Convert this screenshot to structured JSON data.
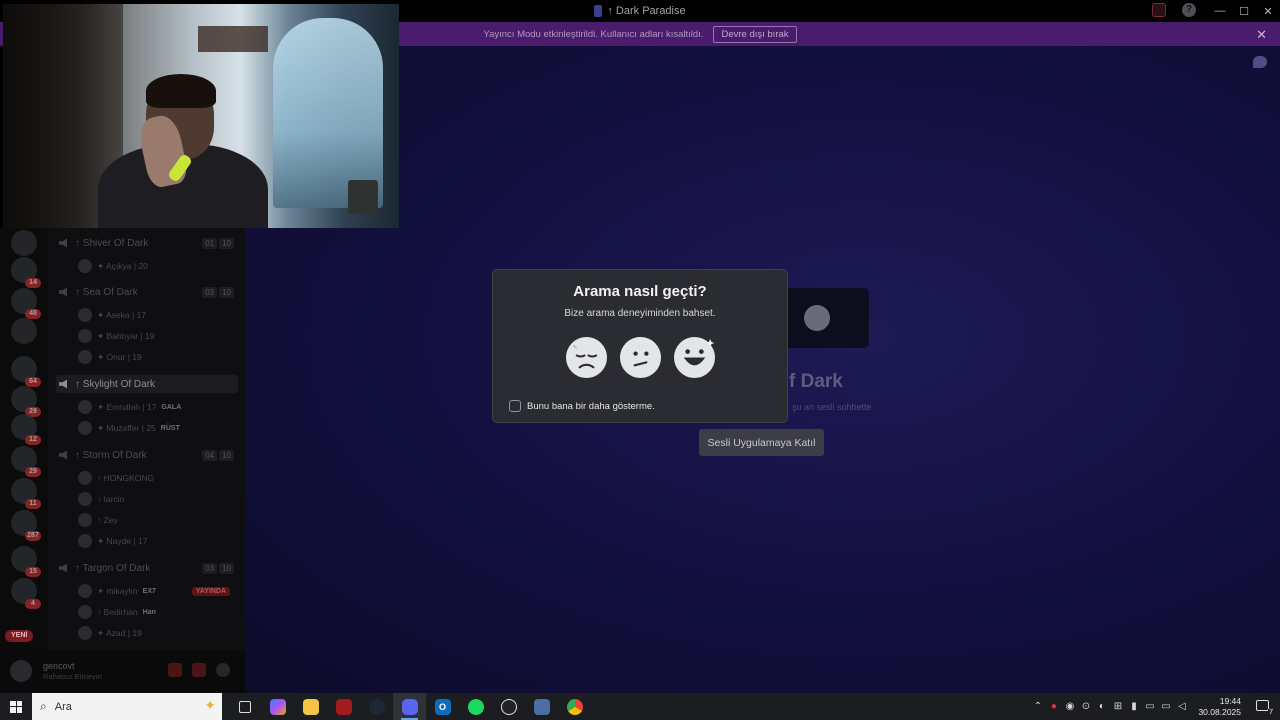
{
  "window": {
    "title": "↑ Dark Paradise",
    "controls": [
      "—",
      "☐",
      "✕"
    ]
  },
  "banner": {
    "text": "Yayıncı Modu etkinleştirildi. Kullanıcı adları kısaltıldı.",
    "button": "Devre dışı bırak",
    "close": "✕"
  },
  "stage": {
    "voice_title": "f Dark",
    "voice_sub": "şu an sesli sohbette",
    "join_button": "Sesli Uygulamaya Katıl"
  },
  "modal": {
    "title": "Arama nasıl geçti?",
    "subtitle": "Bize arama deneyiminden bahset.",
    "ratings": [
      "bad",
      "neutral",
      "good"
    ],
    "checkbox_label": "Bunu bana bir daha gösterme."
  },
  "servers": {
    "badges": [
      "14",
      "48",
      "64",
      "29",
      "12",
      "29",
      "11",
      "287",
      "15",
      "4"
    ],
    "new_label": "YENİ"
  },
  "channels": {
    "items": [
      {
        "name": "↑ Shiver Of Dark",
        "a": "01",
        "b": "10"
      },
      {
        "name": "↑ Sea Of Dark",
        "a": "03",
        "b": "10"
      },
      {
        "name": "↑ Skylight Of Dark",
        "a": "",
        "b": ""
      },
      {
        "name": "↑ Storm Of Dark",
        "a": "04",
        "b": "10"
      },
      {
        "name": "↑ Targon Of Dark",
        "a": "03",
        "b": "10"
      }
    ],
    "users": [
      {
        "name": "✦ Açıkya | 20",
        "tag": "",
        "live": ""
      },
      {
        "name": "✦ Aseka | 17",
        "tag": "",
        "live": ""
      },
      {
        "name": "✦ Bahtıyar | 19",
        "tag": "",
        "live": ""
      },
      {
        "name": "✦ Onur | 19",
        "tag": "",
        "live": ""
      },
      {
        "name": "✦ Emrullah | 17",
        "tag": "GALA",
        "live": ""
      },
      {
        "name": "✦ Muzaffer | 25",
        "tag": "RÜST",
        "live": ""
      },
      {
        "name": "↑ HONGKONG",
        "tag": "",
        "live": ""
      },
      {
        "name": "↑ tarcio",
        "tag": "",
        "live": ""
      },
      {
        "name": "↑ Zey",
        "tag": "",
        "live": ""
      },
      {
        "name": "✦ Nayde | 17",
        "tag": "",
        "live": ""
      },
      {
        "name": "✦ mikaylın",
        "tag": "EX7",
        "live": "YAYINDA"
      },
      {
        "name": "↑ Bedirhan",
        "tag": "Han",
        "live": ""
      },
      {
        "name": "✦ Azad | 19",
        "tag": "",
        "live": ""
      }
    ]
  },
  "userpanel": {
    "name": "gencovt",
    "status": "Rahatsız Etmeyin"
  },
  "taskbar": {
    "search_placeholder": "Ara",
    "time": "19:44",
    "date": "30.08.2025",
    "notifications": "7"
  }
}
